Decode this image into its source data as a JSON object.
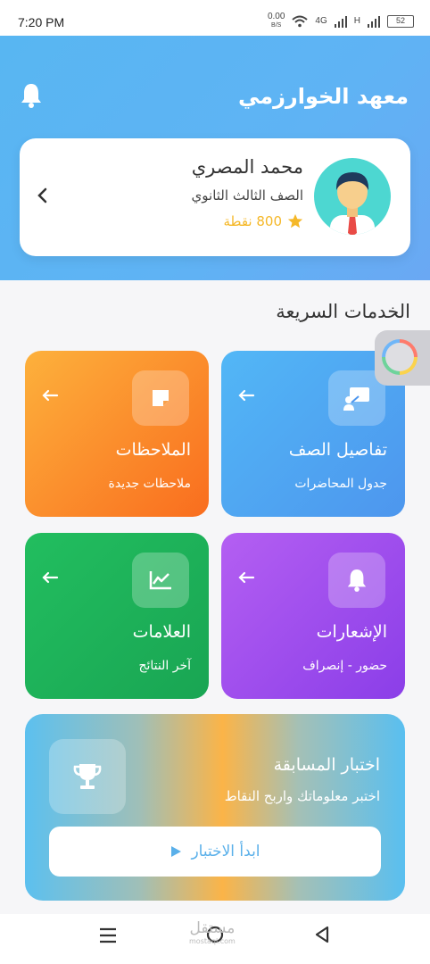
{
  "status_bar": {
    "time": "7:20 PM",
    "net_speed": "0.00",
    "net_unit": "B/S",
    "net_type_1": "4G",
    "net_type_2": "H",
    "battery": "52"
  },
  "header": {
    "app_title": "معهد الخوارزمي"
  },
  "profile": {
    "name": "محمد المصري",
    "grade": "الصف الثالث الثانوي",
    "points": "800 نقطة"
  },
  "quick_services": {
    "title": "الخدمات السريعة",
    "tiles": [
      {
        "title": "تفاصيل الصف",
        "subtitle": "جدول المحاضرات",
        "icon": "presentation-icon"
      },
      {
        "title": "الملاحظات",
        "subtitle": "ملاحظات جديدة",
        "icon": "sticky-note-icon"
      },
      {
        "title": "الإشعارات",
        "subtitle": "حضور - إنصراف",
        "icon": "bell-icon"
      },
      {
        "title": "العلامات",
        "subtitle": "آخر النتائج",
        "icon": "line-chart-icon"
      }
    ]
  },
  "quiz": {
    "title": "اختبار المسابقة",
    "subtitle": "اختبر معلوماتك واربح النقاط",
    "button_label": "ابدأ الاختبار"
  },
  "watermark": {
    "text": "مستقل",
    "sub": "mostaql.com"
  },
  "colors": {
    "header": "#5fb3f4",
    "points": "#f5b829",
    "class_tile": "#4d96ee",
    "notes_tile": "#f96d1e",
    "notif_tile": "#8b3ee8",
    "grades_tile": "#19a553"
  }
}
